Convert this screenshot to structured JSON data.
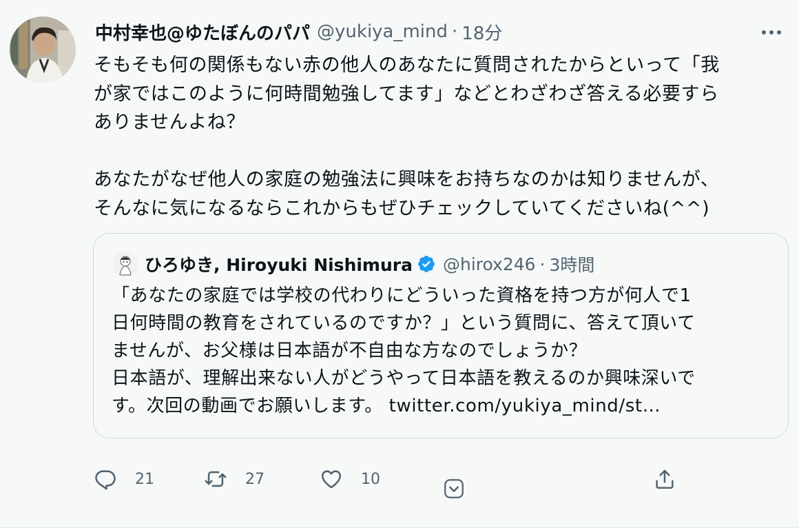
{
  "tweet": {
    "display_name": "中村幸也@ゆたぼんのパパ",
    "handle": "@yukiya_mind",
    "separator": "·",
    "time": "18分",
    "text_lines": [
      "そもそも何の関係もない赤の他人のあなたに質問されたからといって「我",
      "が家ではこのように何時間勉強してます」などとわざわざ答える必要すら",
      "ありませんよね？",
      "あなたがなぜ他人の家庭の勉強法に興味をお持ちなのかは知りませんが、",
      "そんなに気になるならこれからもぜひチェックしていてくださいね(^^)"
    ]
  },
  "quote": {
    "display_name": "ひろゆき, Hiroyuki Nishimura",
    "handle": "@hirox246",
    "separator": "·",
    "time": "3時間",
    "text_lines": [
      "「あなたの家庭では学校の代わりにどういった資格を持つ方が何人で1",
      "日何時間の教育をされているのですか？」という質問に、答えて頂いて",
      "ませんが、お父様は日本語が不自由な方なのでしょうか？",
      "日本語が、理解出来ない人がどうやって日本語を教えるのか興味深いで",
      "す。次回の動画でお願いします。 twitter.com/yukiya_mind/st…"
    ]
  },
  "actions": {
    "reply_count": "21",
    "retweet_count": "27",
    "like_count": "10"
  },
  "icons": {
    "more": "more-horizontal-icon",
    "reply": "reply-icon",
    "retweet": "retweet-icon",
    "like": "heart-icon",
    "down": "chevron-down-icon",
    "share": "share-icon",
    "verified": "verified-badge-icon"
  },
  "colors": {
    "text": "#0f1419",
    "secondary": "#536471",
    "verified": "#1d9bf0",
    "border": "#cfd9de",
    "background": "#f7f9f9"
  }
}
